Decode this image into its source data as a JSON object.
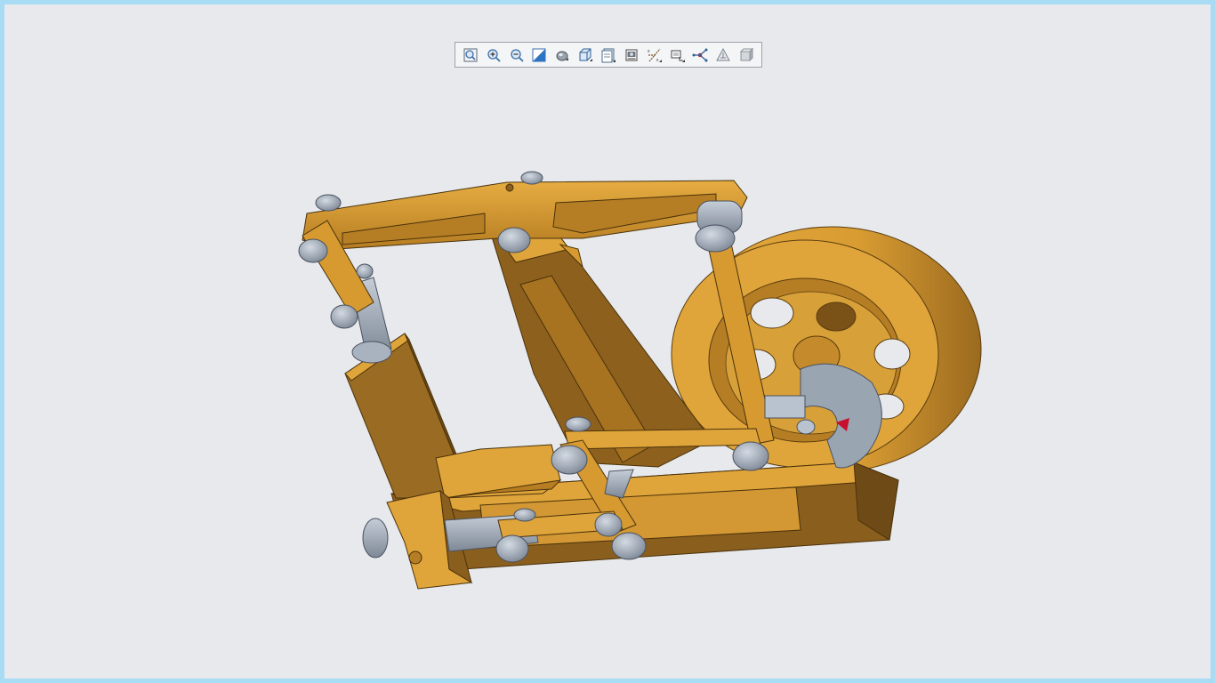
{
  "toolbar": {
    "buttons": [
      {
        "id": "refit",
        "icon": "zoom-fit-icon"
      },
      {
        "id": "zoom-in",
        "icon": "zoom-in-icon"
      },
      {
        "id": "zoom-out",
        "icon": "zoom-out-icon"
      },
      {
        "id": "repaint",
        "icon": "repaint-icon"
      },
      {
        "id": "display-style",
        "icon": "display-style-icon"
      },
      {
        "id": "saved-orientations",
        "icon": "saved-orientations-icon"
      },
      {
        "id": "view-manager",
        "icon": "view-manager-icon"
      },
      {
        "id": "perspective-view",
        "icon": "perspective-view-icon"
      },
      {
        "id": "datum-display-filters",
        "icon": "datum-display-filters-icon"
      },
      {
        "id": "section-view",
        "icon": "section-view-icon"
      },
      {
        "id": "spin-center",
        "icon": "spin-center-icon"
      },
      {
        "id": "annotation-display",
        "icon": "annotation-display-icon"
      },
      {
        "id": "appearance",
        "icon": "appearance-icon"
      }
    ]
  },
  "model": {
    "icon": "mechanism-assembly-model",
    "colors": {
      "part_light": "#e0a53a",
      "part_mid": "#c98f28",
      "part_dark": "#8e6120",
      "part_shadow": "#6e4a16",
      "steel_light": "#b9c3cf",
      "steel_mid": "#9aa5b2",
      "steel_dark": "#6d7784",
      "marker": "#c8102e"
    }
  }
}
